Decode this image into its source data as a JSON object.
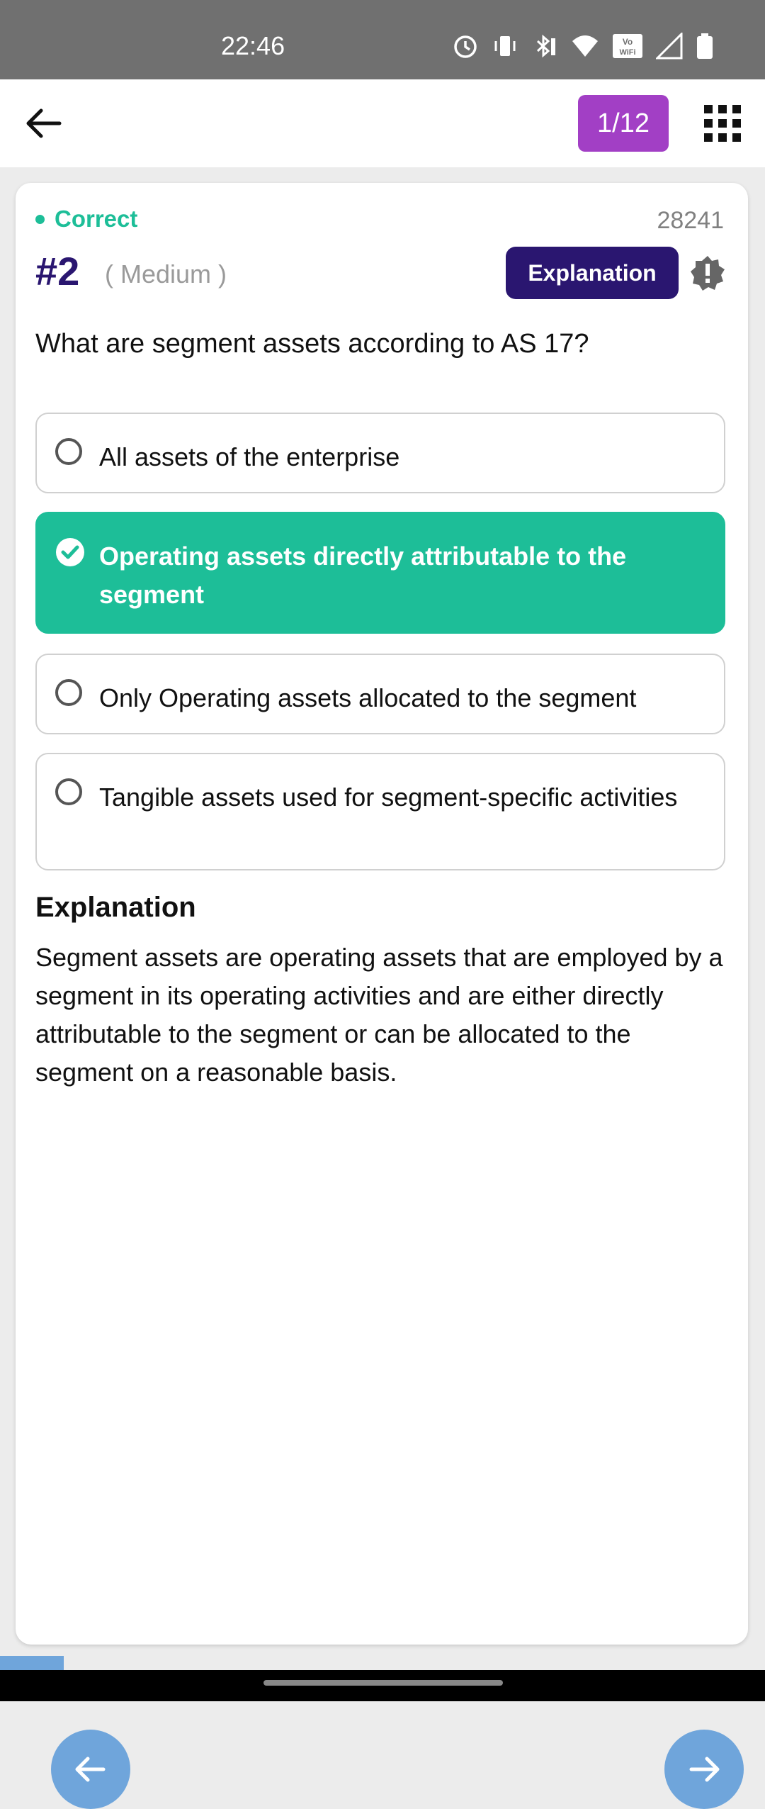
{
  "status_bar": {
    "time": "22:46",
    "icons": [
      "alarm-icon",
      "vibrate-icon",
      "bluetooth-icon",
      "wifi-icon",
      "vowifi-icon",
      "signal-icon",
      "battery-icon"
    ]
  },
  "header": {
    "counter": "1/12",
    "back_icon": "arrow-left-icon",
    "grid_icon": "grid-icon"
  },
  "question": {
    "status": "Correct",
    "id": "28241",
    "number": "#2",
    "difficulty": "( Medium )",
    "explanation_button": "Explanation",
    "text": "What are segment assets according to AS 17?",
    "options": [
      {
        "label": "All assets of the enterprise",
        "selected": false
      },
      {
        "label": "Operating assets directly attributable to the segment",
        "selected": true
      },
      {
        "label": "Only Operating assets allocated to the segment",
        "selected": false
      },
      {
        "label": "Tangible assets used for segment-specific activities",
        "selected": false
      }
    ]
  },
  "explanation": {
    "title": "Explanation",
    "body": "Segment assets are operating assets that are employed by a segment in its operating activities and are either directly attributable to the segment or can be allocated to the segment on a reasonable basis."
  },
  "colors": {
    "correct": "#1dbe98",
    "accent_dark": "#2a1670",
    "counter_bg": "#a23fc5",
    "nav_button": "#6fa5db"
  }
}
